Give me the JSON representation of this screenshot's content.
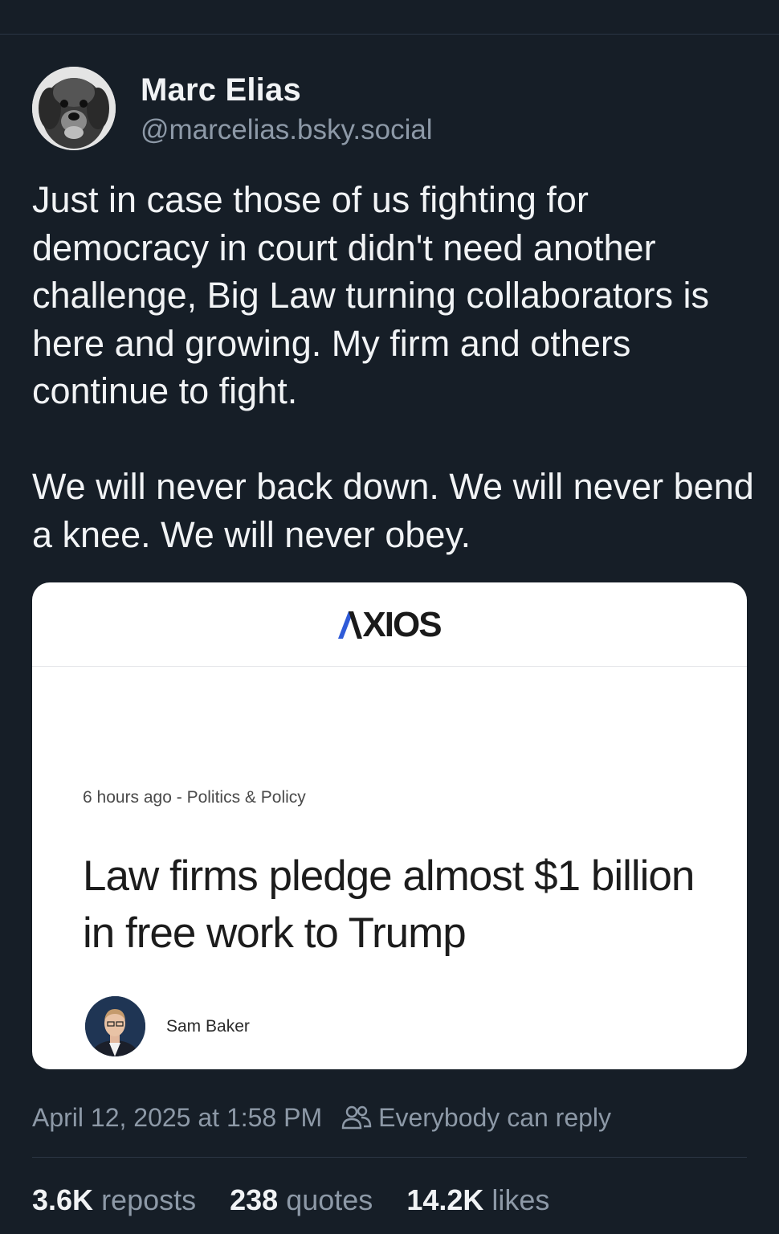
{
  "author": {
    "display_name": "Marc Elias",
    "handle": "@marcelias.bsky.social",
    "avatar_icon": "dog-avatar"
  },
  "post": {
    "paragraphs": [
      "Just in case those of us fighting for democracy in court didn't need another challenge, Big Law turning collaborators is here and growing. My firm and others continue to fight.",
      "We will never back down. We will never bend a knee. We will never obey."
    ]
  },
  "embed": {
    "publisher": "XIOS",
    "meta": "6 hours ago - Politics & Policy",
    "headline": "Law firms pledge almost $1 billion in free work to Trump",
    "author_name": "Sam Baker",
    "accent_color": "#2f5bd8"
  },
  "post_meta": {
    "timestamp": "April 12, 2025 at 1:58 PM",
    "reply_setting": "Everybody can reply",
    "reply_icon": "people-icon"
  },
  "stats": {
    "reposts_count": "3.6K",
    "reposts_label": "reposts",
    "quotes_count": "238",
    "quotes_label": "quotes",
    "likes_count": "14.2K",
    "likes_label": "likes"
  },
  "colors": {
    "background": "#161e27",
    "primary_text": "#f1f3f5",
    "secondary_text": "#8d99a7"
  }
}
